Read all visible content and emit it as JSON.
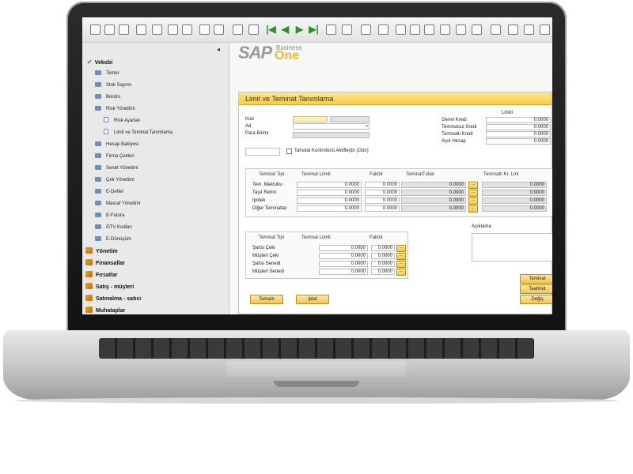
{
  "sidebar": {
    "collapse_glyph": "◂",
    "items": [
      {
        "label": "Vekobi",
        "kind": "section"
      },
      {
        "label": "Temel",
        "kind": "folder"
      },
      {
        "label": "Stok Sayımı",
        "kind": "folder"
      },
      {
        "label": "Bordro",
        "kind": "folder"
      },
      {
        "label": "Risk Yönetimi",
        "kind": "folder"
      },
      {
        "label": "Risk Ayarları",
        "kind": "doc"
      },
      {
        "label": "Limit ve Teminat Tanımlama",
        "kind": "doc"
      },
      {
        "label": "Hesap Bakiyesi",
        "kind": "folder"
      },
      {
        "label": "Firma Çekleri",
        "kind": "folder"
      },
      {
        "label": "Senet Yönetimi",
        "kind": "folder"
      },
      {
        "label": "Çek Yönetimi",
        "kind": "folder"
      },
      {
        "label": "E-Defter",
        "kind": "folder"
      },
      {
        "label": "Masraf Yönetimi",
        "kind": "folder"
      },
      {
        "label": "E-Fatura",
        "kind": "folder"
      },
      {
        "label": "ÖTV Kodları",
        "kind": "folder"
      },
      {
        "label": "E-Dönüşüm",
        "kind": "folder"
      },
      {
        "label": "Yönetim",
        "kind": "module"
      },
      {
        "label": "Finansallar",
        "kind": "module"
      },
      {
        "label": "Fırsatlar",
        "kind": "module"
      },
      {
        "label": "Satış - müşteri",
        "kind": "module"
      },
      {
        "label": "Satınalma - satıcı",
        "kind": "module"
      },
      {
        "label": "Muhataplar",
        "kind": "module"
      }
    ]
  },
  "logo": {
    "sap": "SAP",
    "business": "Business",
    "one": "One"
  },
  "form": {
    "title": "Limit ve Teminat Tanımlama",
    "kod_label": "Kod",
    "ad_label": "Ad",
    "para_birimi_label": "Para Birimi",
    "tahsilat_label": "Tahsilat Kontrolünü Aktifleştir (Gün)",
    "limit_header": "Limiti",
    "limits": [
      {
        "label": "Genel Kredi",
        "value": "0.0000"
      },
      {
        "label": "Teminatsız Kredi",
        "value": "0.0000"
      },
      {
        "label": "Teminatlı Kredi",
        "value": "0.0000"
      },
      {
        "label": "Açık Hesap",
        "value": "0.0000"
      }
    ],
    "teminat_headers": [
      "Teminat Tipi",
      "Teminat Limiti",
      "Faktör",
      "TeminatTutarı",
      "Teminatlı Kr. Lmt"
    ],
    "teminat_rows": [
      {
        "type": "Tem. Mektubu",
        "limit": "0.0000",
        "faktor": "0.0000",
        "tutar": "0.0000",
        "kr_lmt": "0.0000"
      },
      {
        "type": "Taşıt Rehni",
        "limit": "0.0000",
        "faktor": "0.0000",
        "tutar": "0.0000",
        "kr_lmt": "0.0000"
      },
      {
        "type": "İpotek",
        "limit": "0.0000",
        "faktor": "0.0000",
        "tutar": "0.0000",
        "kr_lmt": "0.0000"
      },
      {
        "type": "Diğer Teminatlar",
        "limit": "0.0000",
        "faktor": "0.0000",
        "tutar": "0.0000",
        "kr_lmt": "0.0000"
      }
    ],
    "cek_headers": [
      "Teminat Tipi",
      "Teminat Limiti",
      "Faktör"
    ],
    "cek_rows": [
      {
        "type": "Şahsi Çeki",
        "limit": "0.0000",
        "faktor": "0.0000"
      },
      {
        "type": "Müşteri Çeki",
        "limit": "0.0000",
        "faktor": "0.0000"
      },
      {
        "type": "Şahsi Senedi",
        "limit": "0.0000",
        "faktor": "0.0000"
      },
      {
        "type": "Müşteri Senedi",
        "limit": "0.0000",
        "faktor": "0.0000"
      }
    ],
    "aciklama_label": "Açıklama",
    "dots_label": "...",
    "ok_button": "Tamam",
    "cancel_button": "İptal",
    "right_buttons": [
      "Teminat",
      "Taahhüt",
      "Değiş"
    ]
  }
}
